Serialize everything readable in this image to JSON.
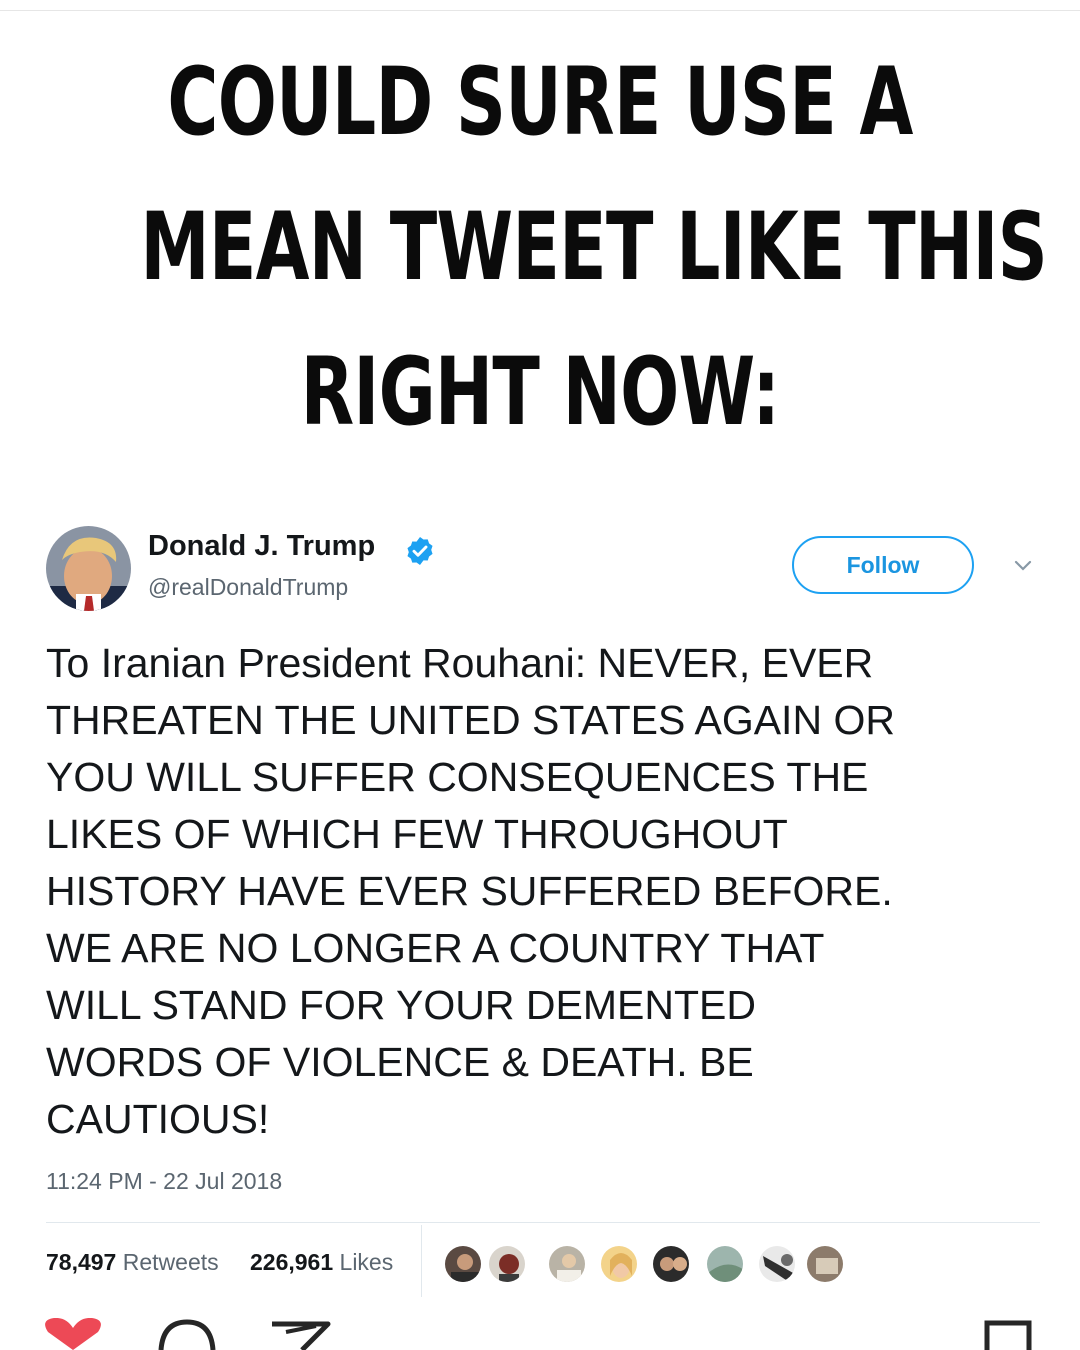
{
  "meme": {
    "headline_lines": [
      "COULD SURE USE A",
      "MEAN TWEET LIKE THIS",
      "RIGHT NOW:"
    ]
  },
  "tweet": {
    "author_name": "Donald J. Trump",
    "handle": "@realDonaldTrump",
    "follow_label": "Follow",
    "text": "To Iranian President Rouhani: NEVER, EVER\nTHREATEN THE UNITED STATES AGAIN OR\nYOU WILL SUFFER CONSEQUENCES THE\nLIKES OF WHICH FEW THROUGHOUT\nHISTORY HAVE EVER SUFFERED BEFORE.\nWE ARE NO LONGER A COUNTRY THAT\nWILL STAND FOR YOUR DEMENTED\nWORDS OF VIOLENCE & DEATH. BE\nCAUTIOUS!",
    "timestamp": "11:24 PM - 22 Jul 2018",
    "retweet_count": "78,497",
    "retweet_label": "Retweets",
    "like_count": "226,961",
    "like_label": "Likes"
  },
  "icons": {
    "verified": "verified-badge-icon",
    "menu": "chevron-down-icon",
    "bottom_bar": [
      "heart-icon",
      "comment-icon",
      "share-icon",
      "bookmark-icon"
    ]
  },
  "colors": {
    "twitter_blue": "#1da1f2",
    "heart_red": "#ed4956"
  }
}
